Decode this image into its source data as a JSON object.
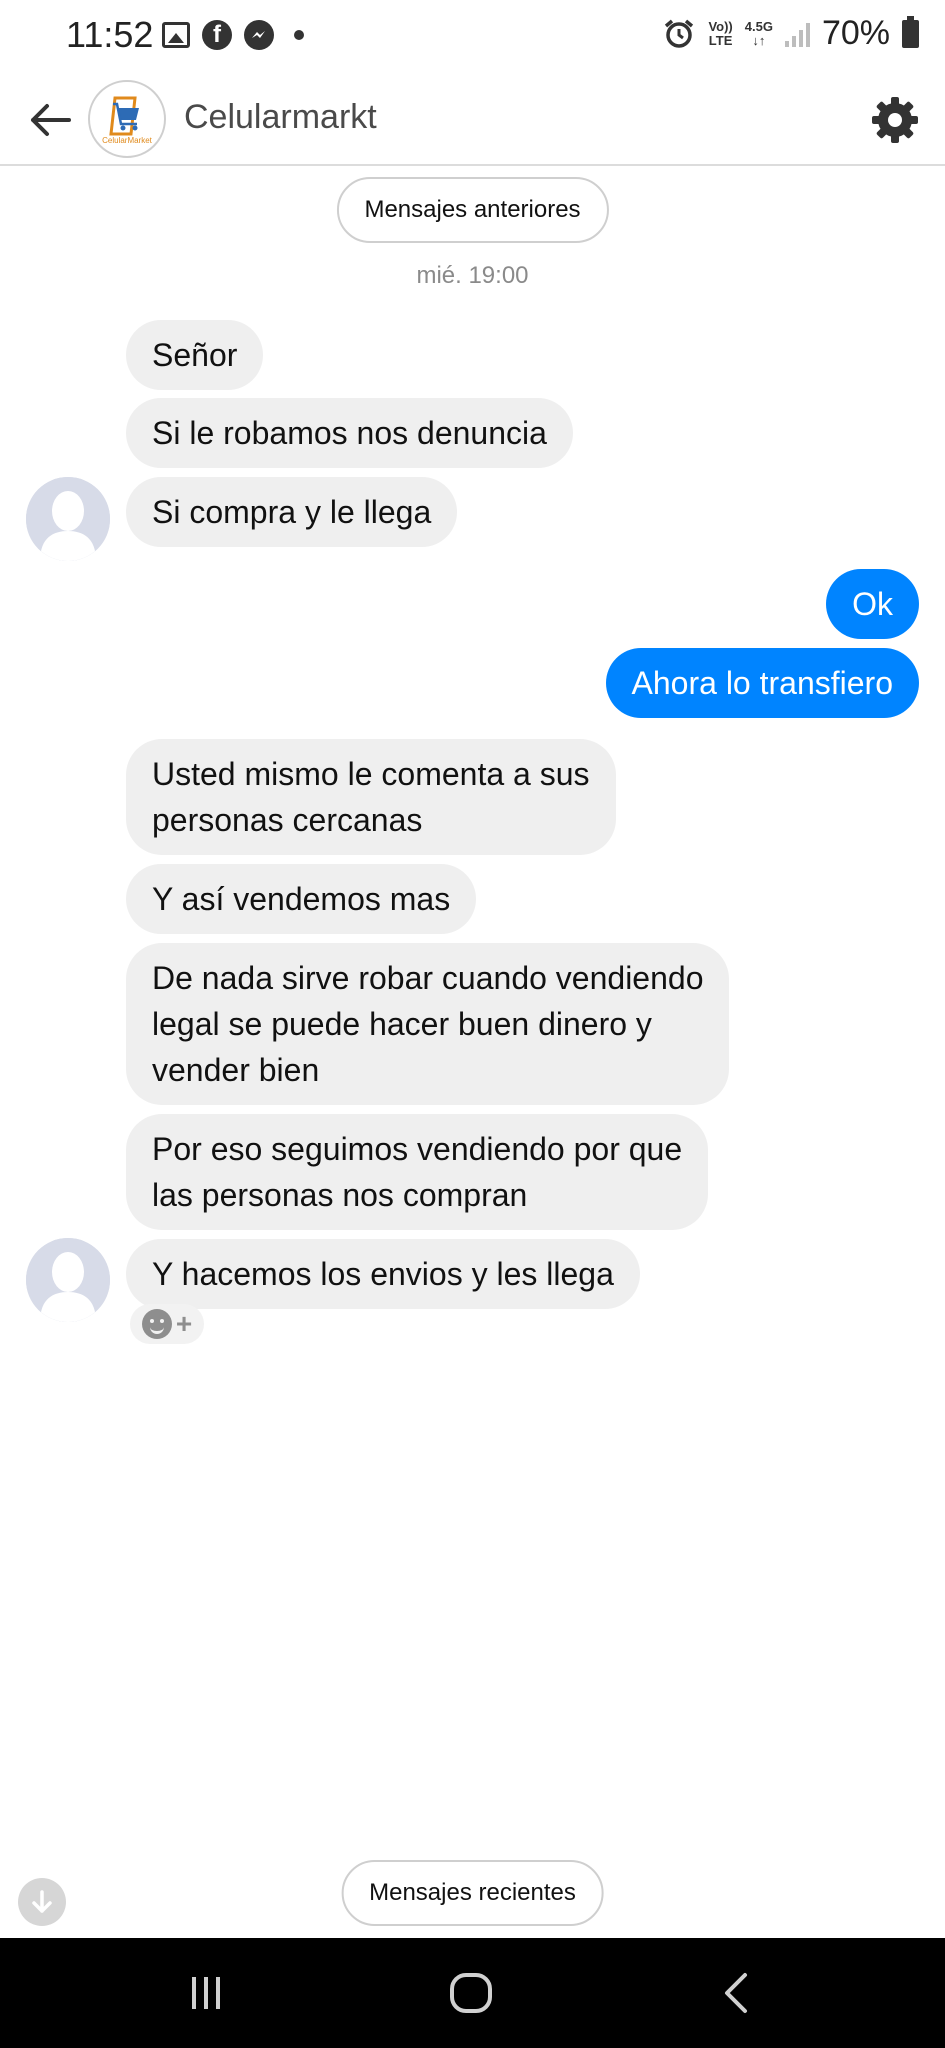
{
  "status_bar": {
    "time": "11:52",
    "volte": "Vo))\nLTE",
    "network": "4.5G",
    "battery": "70%",
    "icons": [
      "gallery-icon",
      "facebook-icon",
      "messenger-icon",
      "dot-icon",
      "alarm-icon",
      "volte-icon",
      "network-arrows-icon",
      "signal-icon",
      "battery-icon"
    ]
  },
  "header": {
    "title": "Celularmarkt",
    "logo_text": "CelularMarket",
    "icons": [
      "back-arrow-icon",
      "shopping-cart-logo",
      "gear-icon"
    ]
  },
  "chat": {
    "older_button": "Mensajes anteriores",
    "newer_button": "Mensajes recientes",
    "timestamp": "mié. 19:00",
    "messages": [
      {
        "from": "page",
        "text": "Señor"
      },
      {
        "from": "page",
        "text": "Si le robamos nos denuncia"
      },
      {
        "from": "page",
        "text": "Si compra y le llega"
      },
      {
        "from": "me",
        "text": "Ok"
      },
      {
        "from": "me",
        "text": "Ahora lo transfiero"
      },
      {
        "from": "page",
        "lines": [
          "Usted mismo le comenta a sus",
          "personas cercanas"
        ]
      },
      {
        "from": "page",
        "text": "Y así vendemos mas"
      },
      {
        "from": "page",
        "lines": [
          "De nada sirve robar cuando vendiendo",
          "legal se puede hacer buen dinero y",
          "vender bien"
        ]
      },
      {
        "from": "page",
        "lines": [
          "Por eso seguimos vendiendo por que",
          "las personas nos compran"
        ]
      },
      {
        "from": "page",
        "text": "Y hacemos los envios y les llega"
      }
    ],
    "reaction_plus": "+"
  },
  "colors": {
    "outgoing_bubble": "#0084ff",
    "incoming_bubble": "#efefef",
    "nav_bar": "#000000"
  }
}
